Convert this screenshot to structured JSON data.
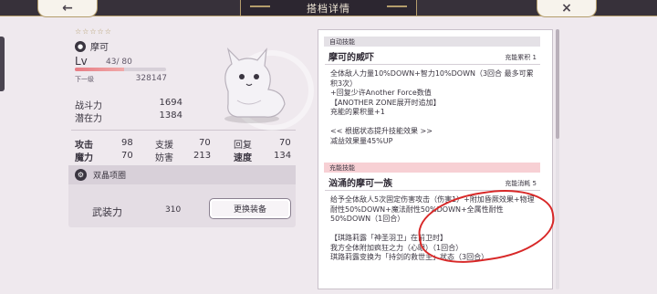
{
  "header": {
    "title": "搭档详情",
    "back_icon": "←",
    "close_icon": "×"
  },
  "partner": {
    "stars": "☆☆☆☆☆",
    "name": "摩可",
    "lv_label": "Lv",
    "lv_value": "43/ 80",
    "exp_fraction": 0.54,
    "next_label": "下一级",
    "next_value": "328147"
  },
  "power": {
    "rows": [
      {
        "label": "战斗力",
        "value": "1694"
      },
      {
        "label": "潜在力",
        "value": "1384"
      }
    ]
  },
  "attributes": [
    {
      "label": "攻击",
      "value": "98",
      "bold": true
    },
    {
      "label": "支援",
      "value": "70",
      "bold": false
    },
    {
      "label": "回复",
      "value": "70",
      "bold": false
    },
    {
      "label": "魔力",
      "value": "70",
      "bold": true
    },
    {
      "label": "妨害",
      "value": "213",
      "bold": false
    },
    {
      "label": "速度",
      "value": "134",
      "bold": true
    }
  ],
  "weapon": {
    "header": "双晶项圈",
    "label": "武装力",
    "value": "310",
    "button": "更换装备"
  },
  "skills": {
    "auto": {
      "header": "自动技能",
      "name": "摩可的威吓",
      "meta": "充能累积 1",
      "text": "全体敌人力量10%DOWN+智力10%DOWN（3回合  最多可累积3次）\n+回复少许Another Force数值\n【ANOTHER ZONE展开时追加】\n充能的累积量+1\n\n<< 根据状态提升技能效果 >>\n减益效果量45%UP"
    },
    "charge": {
      "header": "充能技能",
      "name": "汹涌的摩可一族",
      "meta": "充能消耗 5",
      "text": "给予全体敌人5次固定伤害攻击（伤害1）+附加昏厥效果+物理耐性50%DOWN+魔法耐性50%DOWN+全属性耐性50%DOWN（1回合）\n\n【琪路莉露「神圣羽卫」在前卫时】\n我方全体附加疯狂之力（心眼）（1回合）\n琪路莉露变换为「持剑的救世主」状态（3回合）"
    }
  },
  "colors": {
    "accent": "#b49d6c",
    "annotation": "#d82828",
    "exp_bar": "#e77c84",
    "charge_header": "#f7d0d4"
  }
}
